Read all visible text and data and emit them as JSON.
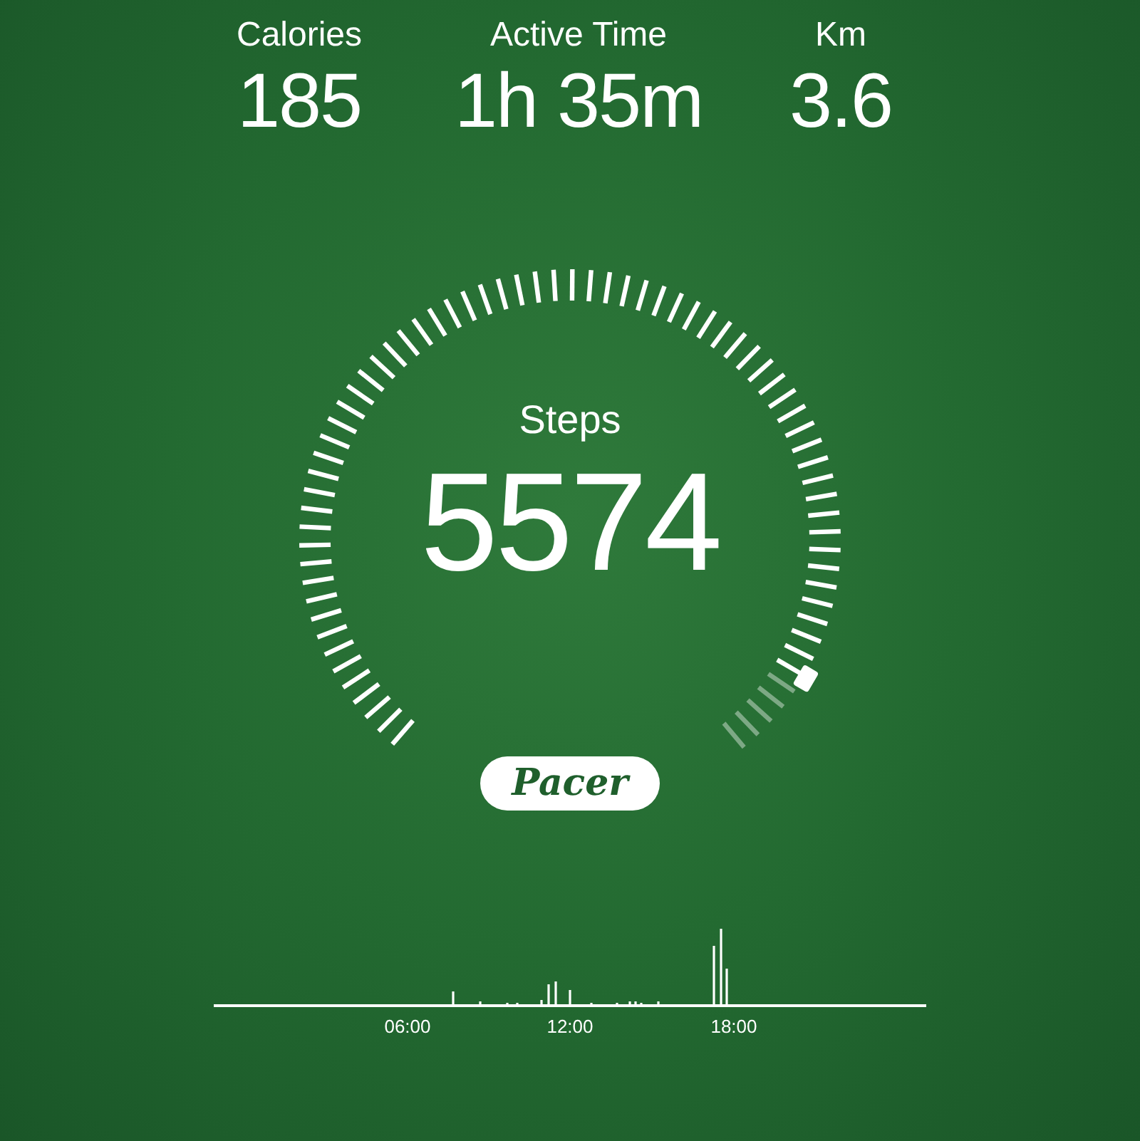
{
  "stats": [
    {
      "label": "Calories",
      "value": "185"
    },
    {
      "label": "Active Time",
      "value": "1h 35m"
    },
    {
      "label": "Km",
      "value": "3.6"
    }
  ],
  "gauge": {
    "label": "Steps",
    "value": "5574"
  },
  "logo": "Pacer",
  "activity_chart": {
    "x_labels": [
      "06:00",
      "12:00",
      "18:00"
    ]
  }
}
